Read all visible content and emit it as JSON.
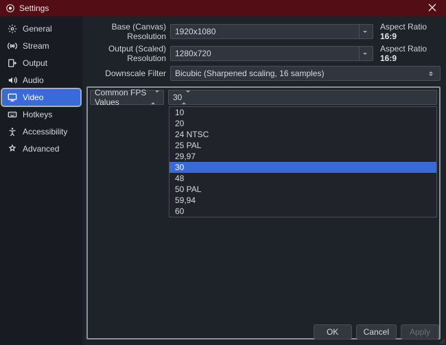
{
  "window": {
    "title": "Settings"
  },
  "sidebar": {
    "items": [
      {
        "label": "General",
        "icon": "gear"
      },
      {
        "label": "Stream",
        "icon": "broadcast"
      },
      {
        "label": "Output",
        "icon": "output"
      },
      {
        "label": "Audio",
        "icon": "speaker"
      },
      {
        "label": "Video",
        "icon": "monitor",
        "selected": true
      },
      {
        "label": "Hotkeys",
        "icon": "keyboard"
      },
      {
        "label": "Accessibility",
        "icon": "accessibility"
      },
      {
        "label": "Advanced",
        "icon": "advanced"
      }
    ]
  },
  "form": {
    "base_label": "Base (Canvas) Resolution",
    "base_value": "1920x1080",
    "base_aspect_label": "Aspect Ratio ",
    "base_aspect_value": "16:9",
    "output_label": "Output (Scaled) Resolution",
    "output_value": "1280x720",
    "output_aspect_label": "Aspect Ratio ",
    "output_aspect_value": "16:9",
    "filter_label": "Downscale Filter",
    "filter_value": "Bicubic (Sharpened scaling, 16 samples)",
    "fps_type_label": "Common FPS Values",
    "fps_value": "30",
    "fps_options": [
      {
        "label": "10"
      },
      {
        "label": "20"
      },
      {
        "label": "24 NTSC"
      },
      {
        "label": "25 PAL"
      },
      {
        "label": "29,97"
      },
      {
        "label": "30",
        "highlight": true
      },
      {
        "label": "48"
      },
      {
        "label": "50 PAL"
      },
      {
        "label": "59,94"
      },
      {
        "label": "60"
      }
    ]
  },
  "footer": {
    "ok": "OK",
    "cancel": "Cancel",
    "apply": "Apply"
  }
}
